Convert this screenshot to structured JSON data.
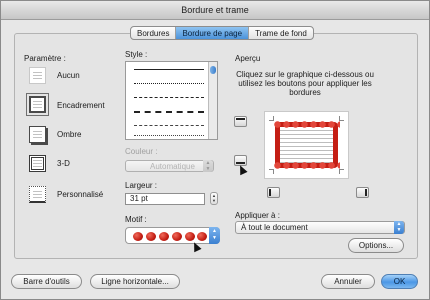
{
  "window": {
    "title": "Bordure et trame"
  },
  "tabs": [
    {
      "label": "Bordures",
      "active": false
    },
    {
      "label": "Bordure de page",
      "active": true
    },
    {
      "label": "Trame de fond",
      "active": false
    }
  ],
  "settings": {
    "heading": "Paramètre :",
    "items": [
      {
        "label": "Aucun",
        "icon": "setting-none-icon"
      },
      {
        "label": "Encadrement",
        "icon": "setting-box-icon",
        "selected": true
      },
      {
        "label": "Ombre",
        "icon": "setting-shadow-icon"
      },
      {
        "label": "3-D",
        "icon": "setting-3d-icon"
      },
      {
        "label": "Personnalisé",
        "icon": "setting-custom-icon"
      }
    ]
  },
  "style": {
    "heading": "Style :"
  },
  "color": {
    "label": "Couleur :",
    "value": "Automatique"
  },
  "width": {
    "label": "Largeur :",
    "value": "31 pt"
  },
  "art": {
    "label": "Motif :",
    "icon": "apple-border-art-icon"
  },
  "preview": {
    "heading": "Aperçu",
    "instructions": "Cliquez sur le graphique ci-dessous ou utilisez les boutons pour appliquer les bordures"
  },
  "apply": {
    "label": "Appliquer à :",
    "value": "À tout le document"
  },
  "buttons": {
    "options": "Options...",
    "toolbar": "Barre d'outils",
    "horizontal_line": "Ligne horizontale...",
    "cancel": "Annuler",
    "ok": "OK"
  },
  "colors": {
    "accent": "#4b97e5",
    "apple_red": "#c41e14"
  }
}
